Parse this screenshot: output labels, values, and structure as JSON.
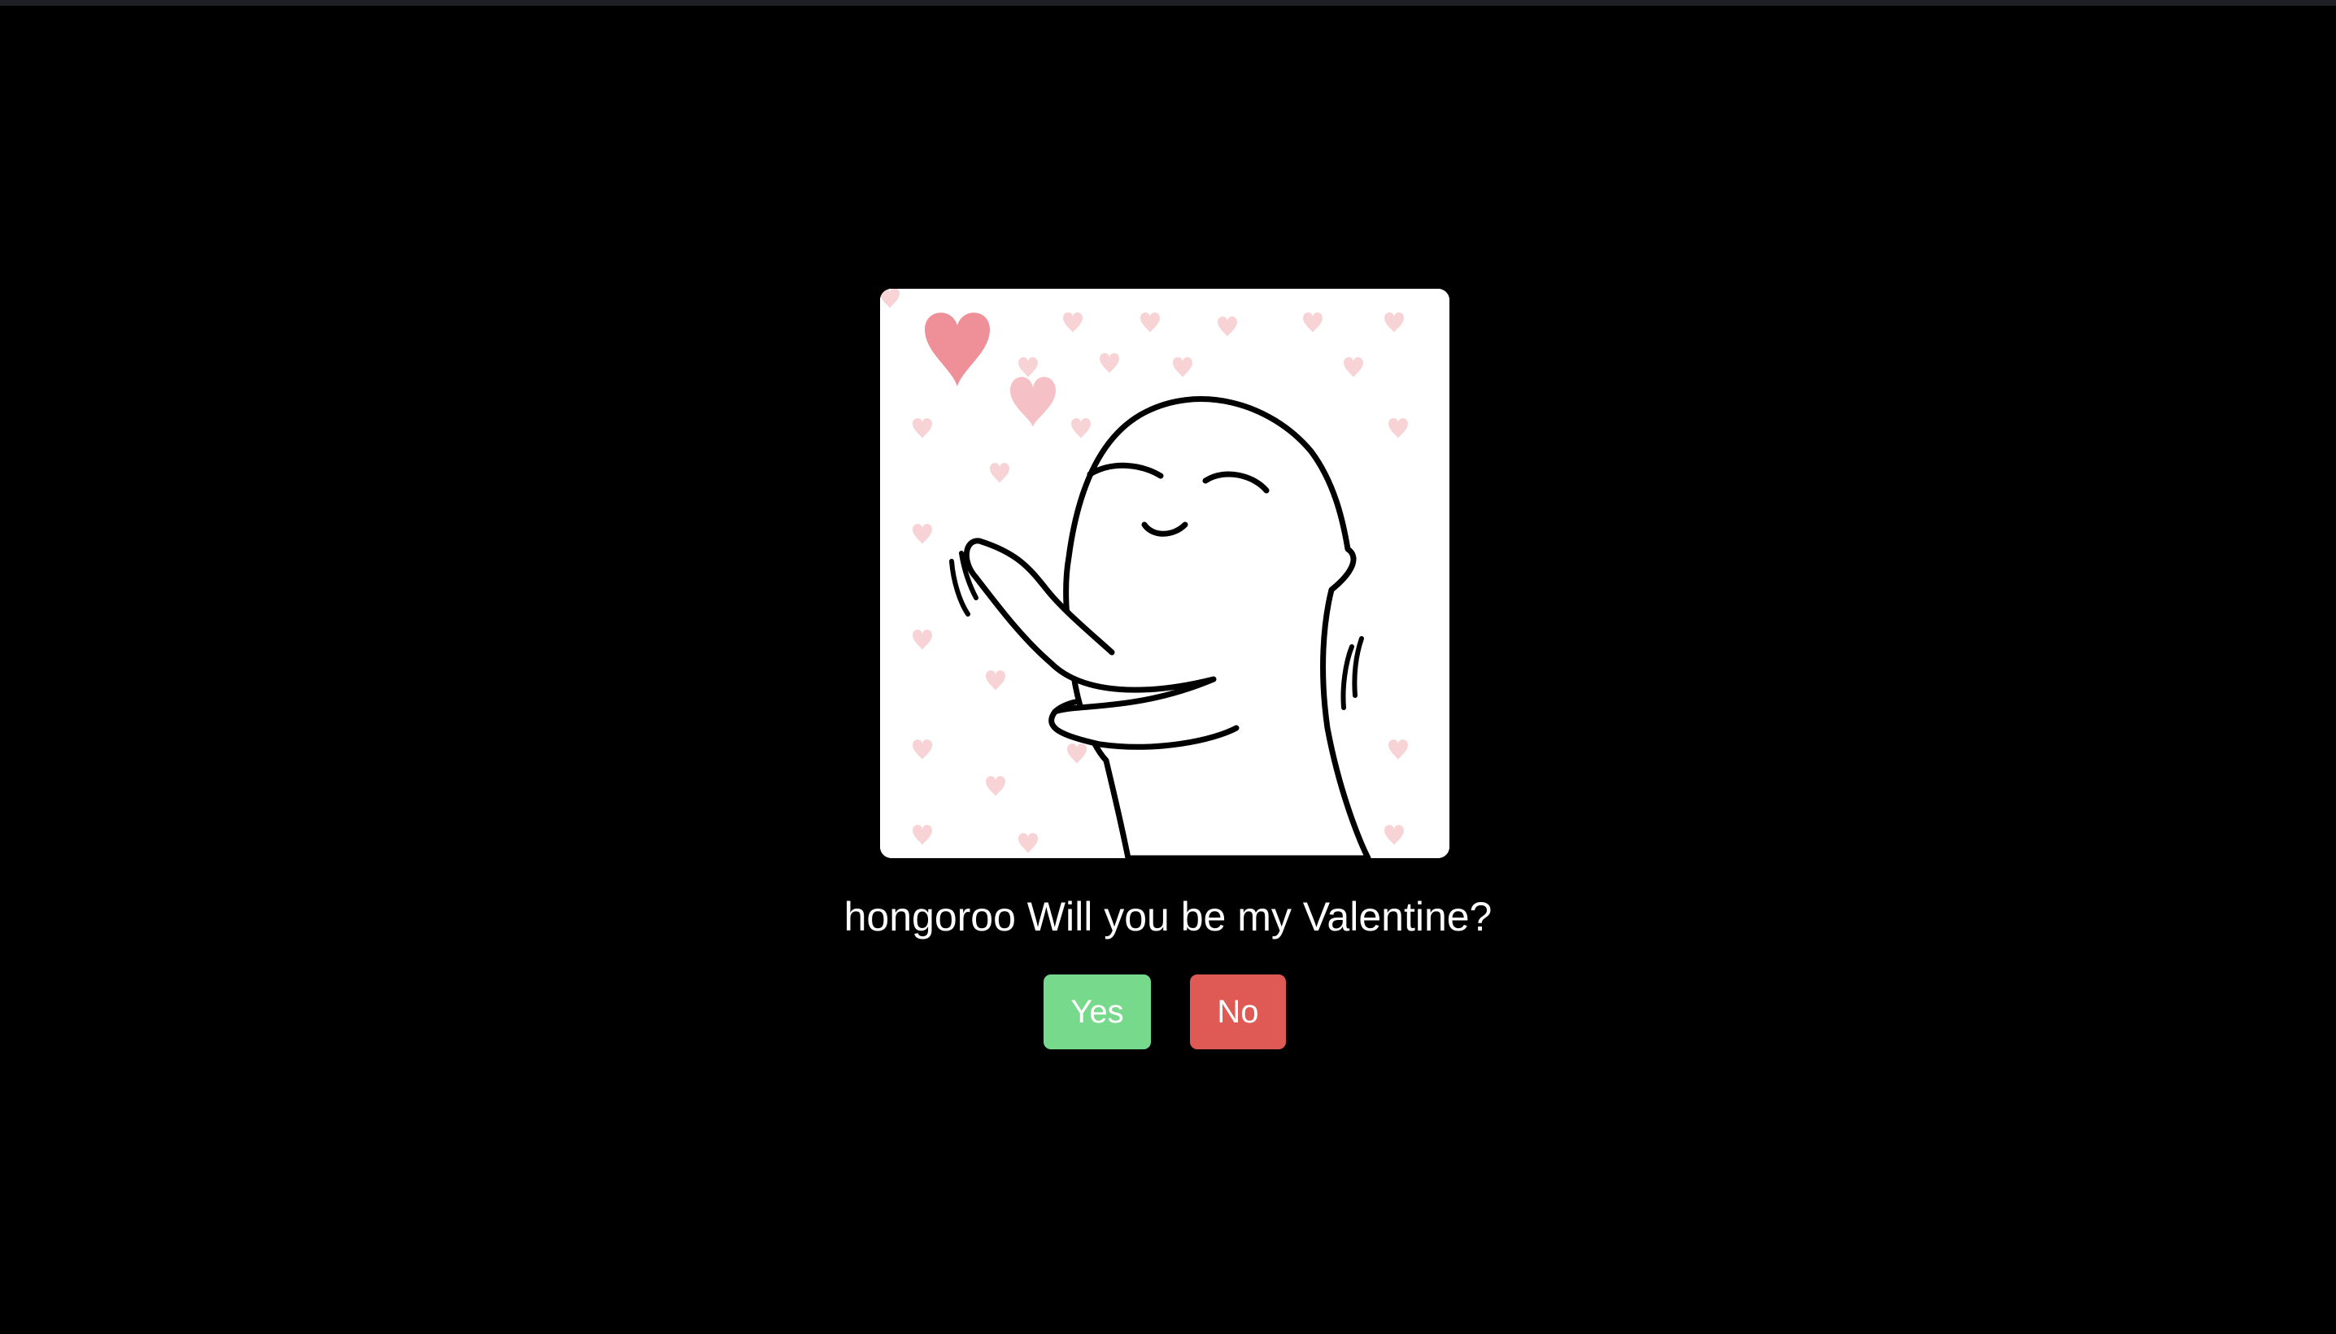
{
  "dialog": {
    "image": {
      "icon": "heart-kiss-illustration",
      "description_colors": {
        "background": "#ffffff",
        "hearts": "#f4a9b0",
        "big_heart": "#ea6f7a",
        "outline": "#000000"
      }
    },
    "question": "hongoroo Will you be my Valentine?",
    "yes_label": "Yes",
    "no_label": "No"
  },
  "colors": {
    "page_background": "#000000",
    "text": "#ffffff",
    "yes_button": "#77d98b",
    "no_button": "#e05a55"
  }
}
